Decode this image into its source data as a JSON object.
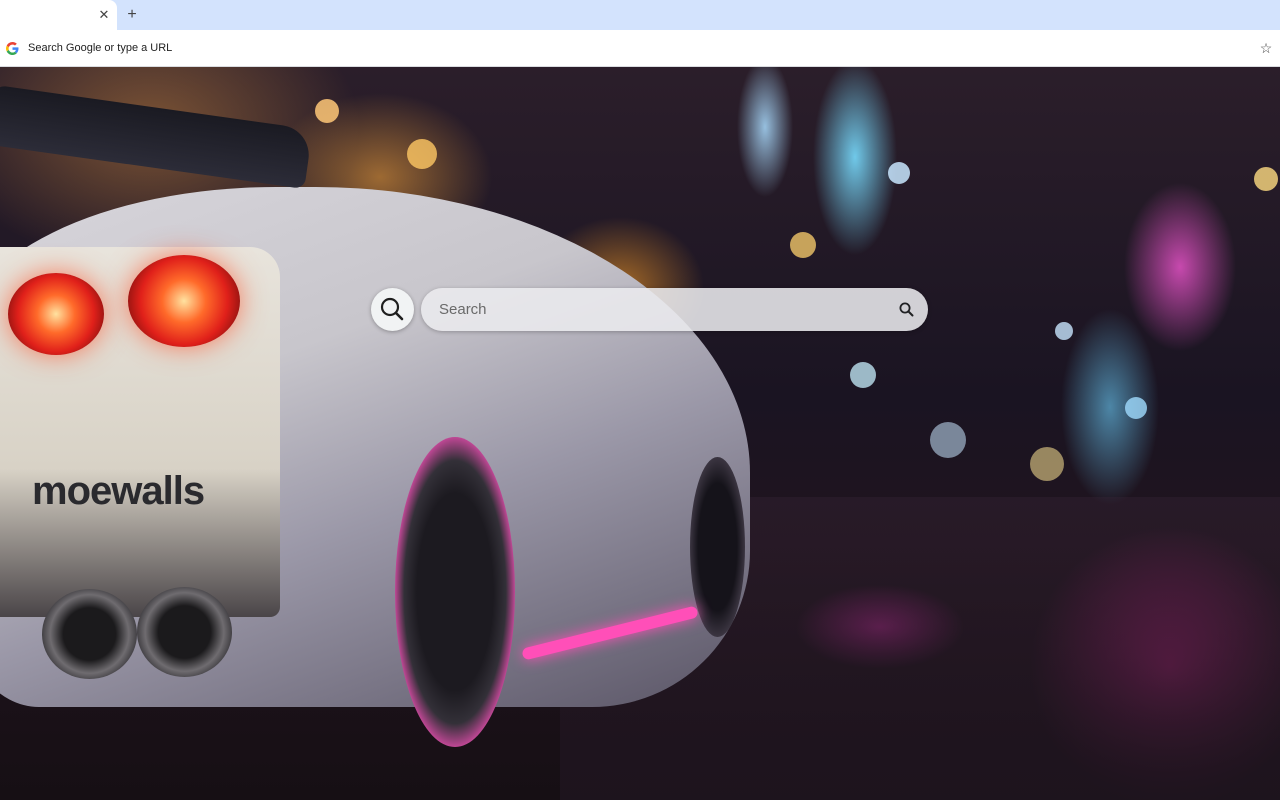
{
  "tabs": [
    {
      "title": "",
      "active": true
    }
  ],
  "tabstrip": {
    "close_glyph": "✕",
    "new_tab_glyph": "+"
  },
  "omnibox": {
    "placeholder": "Search Google or type a URL",
    "icon": "google-g-icon",
    "bookmark_icon": "star-icon",
    "bookmark_glyph": "☆"
  },
  "wallpaper": {
    "brand_text": "moewalls"
  },
  "search": {
    "placeholder": "Search",
    "lens_icon": "search-icon",
    "submit_icon": "search-icon"
  },
  "colors": {
    "tabstrip_bg": "#d3e3fd",
    "toolbar_bg": "#ffffff",
    "neon_pink": "#ff4fb8"
  }
}
